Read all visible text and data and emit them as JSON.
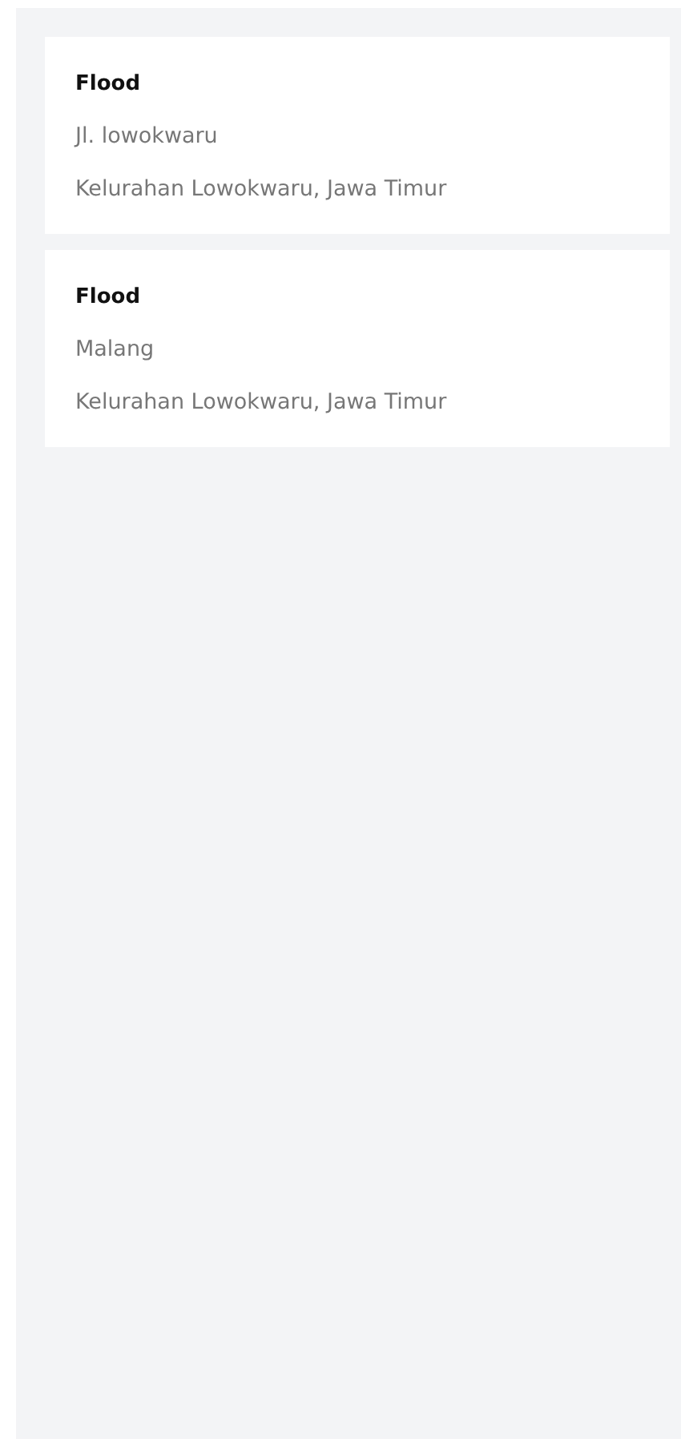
{
  "reports": [
    {
      "type": "Flood",
      "street": "Jl. lowokwaru",
      "area": "Kelurahan Lowokwaru, Jawa Timur"
    },
    {
      "type": "Flood",
      "street": "Malang",
      "area": "Kelurahan Lowokwaru, Jawa Timur"
    }
  ]
}
